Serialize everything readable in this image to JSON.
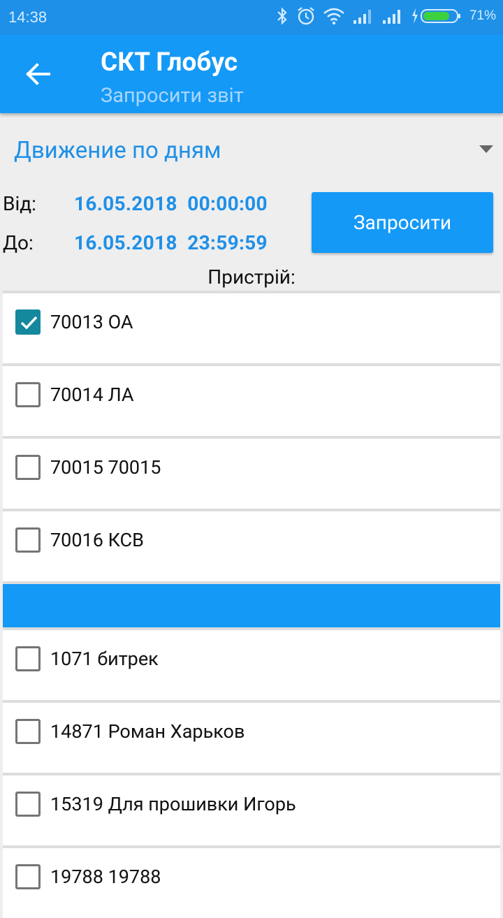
{
  "status": {
    "time": "14:38",
    "battery": "71%"
  },
  "appbar": {
    "title": "СКТ Глобус",
    "subtitle": "Запросити звіт"
  },
  "report_type": "Движение по дням",
  "from": {
    "label": "Від:",
    "date": "16.05.2018",
    "time": "00:00:00"
  },
  "to": {
    "label": "До:",
    "date": "16.05.2018",
    "time": "23:59:59"
  },
  "request_button": "Запросити",
  "device_label": "Пристрій:",
  "devices_group1": [
    {
      "label": "70013 ОА",
      "checked": true
    },
    {
      "label": "70014 ЛА",
      "checked": false
    },
    {
      "label": "70015 70015",
      "checked": false
    },
    {
      "label": "70016 КСВ",
      "checked": false
    }
  ],
  "devices_group2": [
    {
      "label": "1071 битрек",
      "checked": false
    },
    {
      "label": "14871 Роман Харьков",
      "checked": false
    },
    {
      "label": "15319 Для прошивки Игорь",
      "checked": false
    },
    {
      "label": "19788 19788",
      "checked": false
    }
  ],
  "colors": {
    "primary": "#1499f7",
    "checked": "#14889d"
  }
}
